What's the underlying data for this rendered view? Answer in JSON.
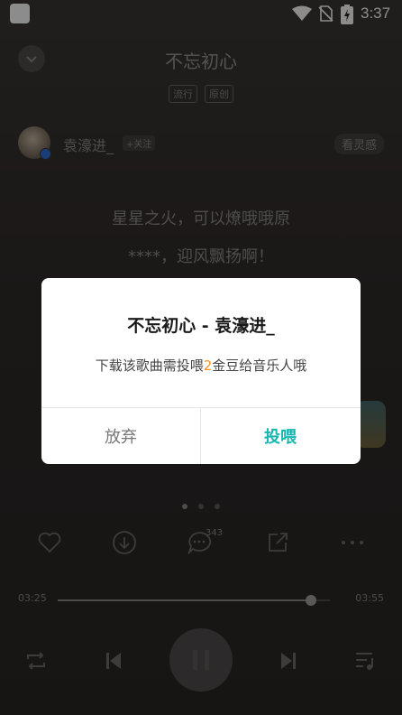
{
  "status_bar": {
    "time": "3:37"
  },
  "header": {
    "title": "不忘初心",
    "tags": [
      "流行",
      "原创"
    ]
  },
  "artist": {
    "name": "袁濠进_",
    "follow_label": "+关注",
    "inspiration_label": "看灵感"
  },
  "lyrics": [
    "星星之火，可以燎哦哦原",
    "****，迎风飘扬啊！"
  ],
  "actions": {
    "comment_count": "343"
  },
  "progress": {
    "elapsed": "03:25",
    "total": "03:55",
    "fraction": 0.93
  },
  "dialog": {
    "title": "不忘初心 - 袁濠进_",
    "message_before": "下载该歌曲需投喂",
    "message_amount": "2",
    "message_after": "金豆给音乐人哦",
    "cancel_label": "放弃",
    "confirm_label": "投喂",
    "accent_color": "#18b6b0",
    "highlight_color": "#ff8f1f"
  }
}
